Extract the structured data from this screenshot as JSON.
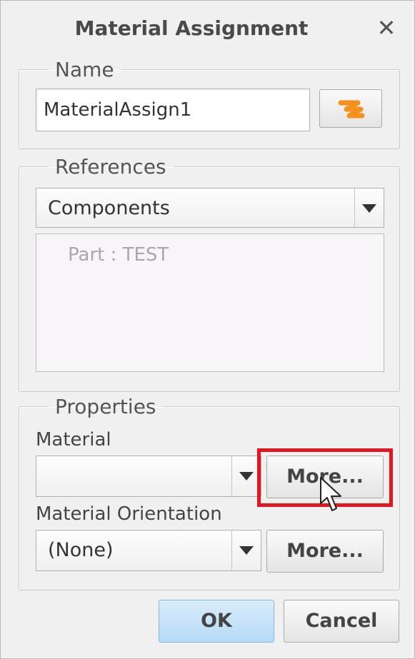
{
  "window": {
    "title": "Material Assignment",
    "close_icon": "close-icon"
  },
  "name_section": {
    "legend": "Name",
    "value": "MaterialAssign1",
    "regen_icon": "regenerate-icon",
    "regen_icon_color": "#f5901e"
  },
  "references_section": {
    "legend": "References",
    "selected": "Components",
    "items": [
      "Part : TEST"
    ]
  },
  "properties_section": {
    "legend": "Properties",
    "material_label": "Material",
    "material_value": "",
    "material_more": "More...",
    "orientation_label": "Material Orientation",
    "orientation_value": "(None)",
    "orientation_more": "More..."
  },
  "footer": {
    "ok": "OK",
    "cancel": "Cancel"
  },
  "highlight_color": "#e3161f"
}
